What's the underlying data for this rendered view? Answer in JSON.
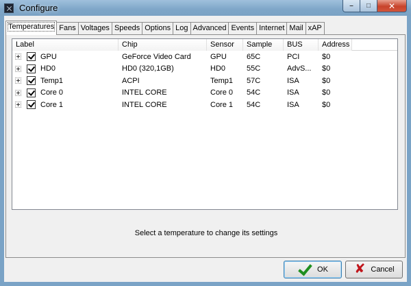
{
  "window": {
    "title": "Configure"
  },
  "tabs": [
    {
      "label": "Temperatures",
      "active": true
    },
    {
      "label": "Fans"
    },
    {
      "label": "Voltages"
    },
    {
      "label": "Speeds"
    },
    {
      "label": "Options"
    },
    {
      "label": "Log"
    },
    {
      "label": "Advanced"
    },
    {
      "label": "Events"
    },
    {
      "label": "Internet"
    },
    {
      "label": "Mail"
    },
    {
      "label": "xAP"
    }
  ],
  "table": {
    "columns": [
      "Label",
      "Chip",
      "Sensor",
      "Sample",
      "BUS",
      "Address"
    ],
    "rows": [
      {
        "label": "GPU",
        "chip": "GeForce Video Card",
        "sensor": "GPU",
        "sample": "65C",
        "bus": "PCI",
        "address": "$0"
      },
      {
        "label": "HD0",
        "chip": "HD0 (320,1GB)",
        "sensor": "HD0",
        "sample": "55C",
        "bus": "AdvS...",
        "address": "$0"
      },
      {
        "label": "Temp1",
        "chip": "ACPI",
        "sensor": "Temp1",
        "sample": "57C",
        "bus": "ISA",
        "address": "$0"
      },
      {
        "label": "Core 0",
        "chip": "INTEL CORE",
        "sensor": "Core 0",
        "sample": "54C",
        "bus": "ISA",
        "address": "$0"
      },
      {
        "label": "Core 1",
        "chip": "INTEL CORE",
        "sensor": "Core 1",
        "sample": "54C",
        "bus": "ISA",
        "address": "$0"
      }
    ]
  },
  "status_text": "Select a temperature to change its settings",
  "buttons": {
    "ok": "OK",
    "cancel": "Cancel"
  },
  "colors": {
    "title_bar": "#7ea6c8",
    "ok_icon": "#1f8f1f",
    "cancel_icon": "#c0151b",
    "close_button": "#c7432b"
  }
}
